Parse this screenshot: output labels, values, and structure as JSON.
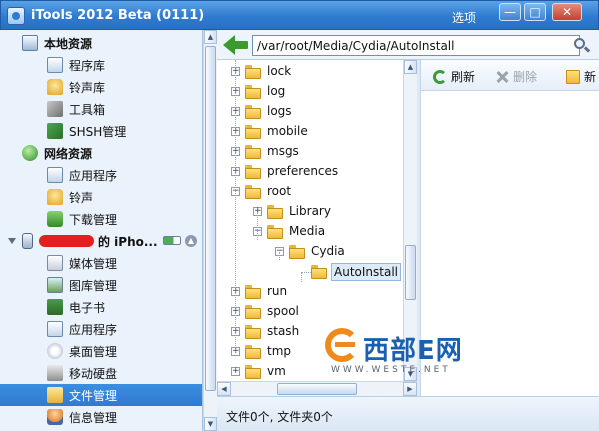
{
  "window": {
    "title": "iTools 2012 Beta (0111)",
    "options_label": "选项",
    "minimize_label": "—",
    "maximize_label": "□",
    "close_label": "✕"
  },
  "nav": {
    "local": {
      "label": "本地资源",
      "items": [
        "程序库",
        "铃声库",
        "工具箱",
        "SHSH管理"
      ]
    },
    "network": {
      "label": "网络资源",
      "items": [
        "应用程序",
        "铃声",
        "下载管理"
      ]
    },
    "device": {
      "label_suffix": "的 iPho...",
      "items": [
        "媒体管理",
        "图库管理",
        "电子书",
        "应用程序",
        "桌面管理",
        "移动硬盘",
        "文件管理",
        "信息管理"
      ],
      "selected": "文件管理"
    }
  },
  "path": {
    "value": "/var/root/Media/Cydia/AutoInstall"
  },
  "tree": {
    "items": [
      {
        "label": "lock",
        "depth": 0,
        "expander": "+"
      },
      {
        "label": "log",
        "depth": 0,
        "expander": "+"
      },
      {
        "label": "logs",
        "depth": 0,
        "expander": "+"
      },
      {
        "label": "mobile",
        "depth": 0,
        "expander": "+"
      },
      {
        "label": "msgs",
        "depth": 0,
        "expander": "+"
      },
      {
        "label": "preferences",
        "depth": 0,
        "expander": "+"
      },
      {
        "label": "root",
        "depth": 0,
        "expander": "−"
      },
      {
        "label": "Library",
        "depth": 1,
        "expander": "+"
      },
      {
        "label": "Media",
        "depth": 1,
        "expander": "−"
      },
      {
        "label": "Cydia",
        "depth": 2,
        "expander": "−"
      },
      {
        "label": "AutoInstall",
        "depth": 3,
        "expander": "",
        "selected": true
      },
      {
        "label": "run",
        "depth": 0,
        "expander": "+"
      },
      {
        "label": "spool",
        "depth": 0,
        "expander": "+"
      },
      {
        "label": "stash",
        "depth": 0,
        "expander": "+"
      },
      {
        "label": "tmp",
        "depth": 0,
        "expander": "+"
      },
      {
        "label": "vm",
        "depth": 0,
        "expander": "+"
      }
    ]
  },
  "toolbar": {
    "refresh_label": "刷新",
    "delete_label": "删除",
    "new_label": "新"
  },
  "status": {
    "text": "文件0个, 文件夹0个"
  },
  "watermark": {
    "brand": "西部E网",
    "url": "WWW.WESTE.NET"
  },
  "colors": {
    "titlebar": "#2f7bd0",
    "selected_nav": "#3b8ee0",
    "folder": "#f0b93a",
    "back_arrow": "#3a9a2e",
    "watermark_orange": "#f08a1c",
    "watermark_blue": "#1a5fb0"
  }
}
